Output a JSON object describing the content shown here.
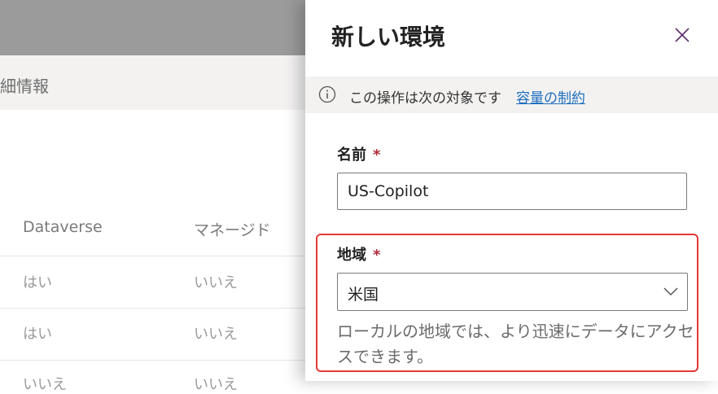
{
  "background": {
    "subbar_text": "細情報",
    "table": {
      "headers": [
        "Dataverse",
        "マネージド"
      ],
      "rows": [
        [
          "はい",
          "いいえ"
        ],
        [
          "はい",
          "いいえ"
        ],
        [
          "いいえ",
          "いいえ"
        ]
      ]
    }
  },
  "panel": {
    "title": "新しい環境",
    "close_icon": "close-icon",
    "info": {
      "icon": "info-icon",
      "text": "この操作は次の対象です",
      "link_text": "容量の制約"
    },
    "name_field": {
      "label": "名前",
      "required_mark": "*",
      "value": "US-Copilot"
    },
    "region_field": {
      "label": "地域",
      "required_mark": "*",
      "selected": "米国",
      "help": "ローカルの地域では、より迅速にデータにアクセスできます。"
    }
  },
  "colors": {
    "accent_link": "#1f6fbf",
    "required": "#b02a37",
    "highlight_border": "#e53935"
  }
}
